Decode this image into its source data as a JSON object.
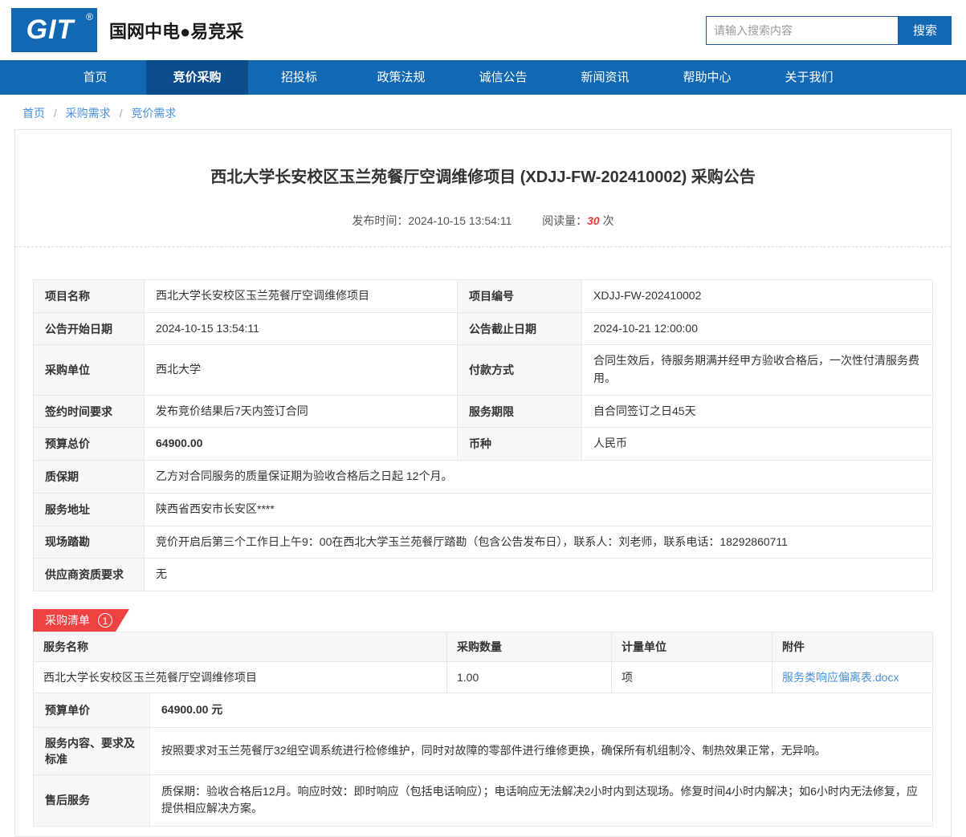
{
  "colors": {
    "primary_blue": "#1268b3",
    "nav_active_blue": "#0c4d8c",
    "accent_red": "#ef4242",
    "text_red": "#e53c3c",
    "link_blue": "#4a90d9"
  },
  "header": {
    "logo_text": "GIT",
    "logo_reg_mark": "®",
    "brand": "国网中电●易竞采",
    "search": {
      "placeholder": "请输入搜索内容",
      "button_label": "搜索"
    }
  },
  "nav": {
    "items": [
      {
        "label": "首页",
        "active": false
      },
      {
        "label": "竞价采购",
        "active": true
      },
      {
        "label": "招投标",
        "active": false
      },
      {
        "label": "政策法规",
        "active": false
      },
      {
        "label": "诚信公告",
        "active": false
      },
      {
        "label": "新闻资讯",
        "active": false
      },
      {
        "label": "帮助中心",
        "active": false
      },
      {
        "label": "关于我们",
        "active": false
      }
    ]
  },
  "breadcrumb": {
    "items": [
      "首页",
      "采购需求",
      "竞价需求"
    ],
    "separator": "/"
  },
  "announcement": {
    "title": "西北大学长安校区玉兰苑餐厅空调维修项目 (XDJJ-FW-202410002) 采购公告",
    "publish_label": "发布时间：",
    "publish_time": "2024-10-15 13:54:11",
    "views_label": "阅读量：",
    "views_count": "30",
    "views_unit": "次"
  },
  "info_table": {
    "rows2col": [
      {
        "label1": "项目名称",
        "value1": "西北大学长安校区玉兰苑餐厅空调维修项目",
        "label2": "项目编号",
        "value2": "XDJJ-FW-202410002"
      },
      {
        "label1": "公告开始日期",
        "value1": "2024-10-15 13:54:11",
        "label2": "公告截止日期",
        "value2": "2024-10-21 12:00:00"
      },
      {
        "label1": "采购单位",
        "value1": "西北大学",
        "label2": "付款方式",
        "value2": "合同生效后，待服务期满并经甲方验收合格后，一次性付清服务费用。"
      },
      {
        "label1": "签约时间要求",
        "value1": "发布竞价结果后7天内签订合同",
        "label2": "服务期限",
        "value2": "自合同签订之日45天"
      },
      {
        "label1": "预算总价",
        "value1": "64900.00",
        "label2": "币种",
        "value2": "人民币"
      }
    ],
    "rows1col": [
      {
        "label": "质保期",
        "value": "乙方对合同服务的质量保证期为验收合格后之日起 12个月。"
      },
      {
        "label": "服务地址",
        "value": "陕西省西安市长安区****"
      },
      {
        "label": "现场踏勘",
        "value": "竞价开启后第三个工作日上午9：00在西北大学玉兰苑餐厅踏勘（包含公告发布日），联系人：刘老师，联系电话：18292860711"
      },
      {
        "label": "供应商资质要求",
        "value": "无"
      }
    ]
  },
  "purchase_list": {
    "tag_label": "采购清单",
    "tag_count": "1",
    "table": {
      "headers": [
        "服务名称",
        "采购数量",
        "计量单位",
        "附件"
      ],
      "row": {
        "service_name": "西北大学长安校区玉兰苑餐厅空调维修项目",
        "quantity": "1.00",
        "unit": "项",
        "attachment": "服务类响应偏离表.docx"
      }
    },
    "detail_rows": [
      {
        "label": "预算单价",
        "value": "64900.00 元"
      },
      {
        "label": "服务内容、要求及标准",
        "value": "按照要求对玉兰苑餐厅32组空调系统进行检修维护，同时对故障的零部件进行维修更换，确保所有机组制冷、制热效果正常，无异响。"
      },
      {
        "label": "售后服务",
        "value": "质保期：验收合格后12月。响应时效：即时响应（包括电话响应）；电话响应无法解决2小时内到达现场。修复时间4小时内解决；如6小时内无法修复，应提供相应解决方案。"
      }
    ]
  }
}
